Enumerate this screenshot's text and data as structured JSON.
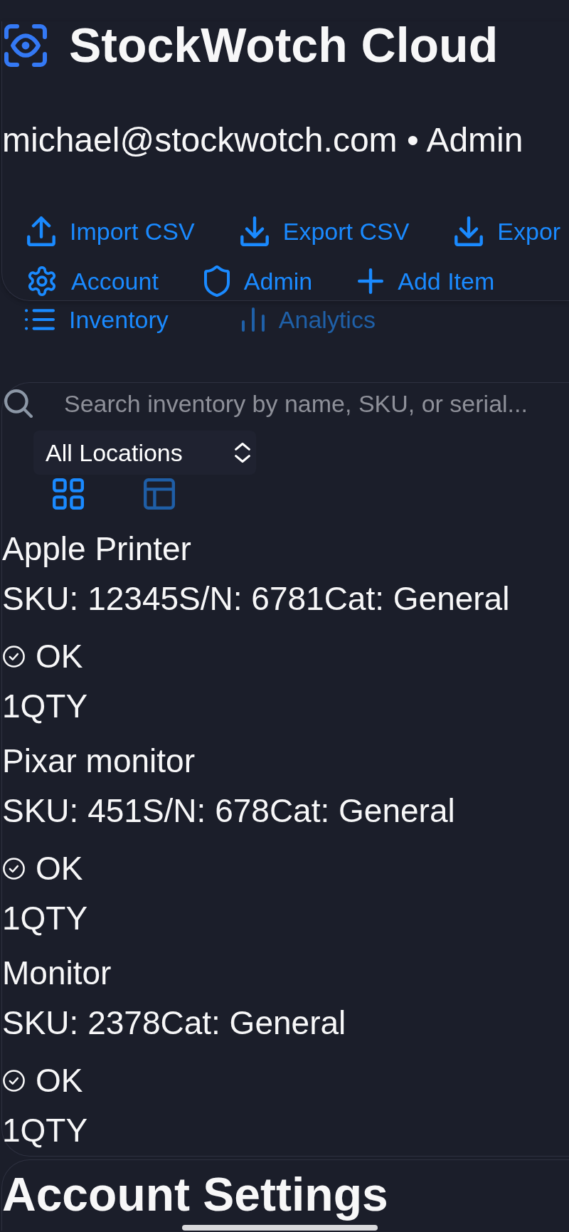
{
  "header": {
    "title": "StockWotch Cloud",
    "user_line": "michael@stockwotch.com • Admin"
  },
  "toolbar": {
    "rows": [
      {
        "buttons": [
          {
            "kind": "import",
            "label": "Import CSV"
          },
          {
            "kind": "export",
            "label": "Export CSV"
          },
          {
            "kind": "export",
            "label": "Expor"
          }
        ]
      },
      {
        "buttons": [
          {
            "kind": "settings",
            "label": "Account"
          },
          {
            "kind": "admin",
            "label": "Admin"
          },
          {
            "kind": "add",
            "label": "Add Item"
          }
        ]
      }
    ]
  },
  "tabs": [
    {
      "kind": "list",
      "label": "Inventory",
      "selected": true
    },
    {
      "kind": "chart",
      "label": "Analytics",
      "selected": false
    }
  ],
  "search": {
    "placeholder": "Search inventory by name, SKU, or serial..."
  },
  "location_filter": {
    "value": "All Locations"
  },
  "view_modes": [
    {
      "kind": "grid",
      "selected": true
    },
    {
      "kind": "table",
      "selected": false
    }
  ],
  "items": [
    {
      "name": "Apple Printer",
      "details": "SKU: 12345S/N: 6781Cat: General",
      "status": "OK",
      "quantity": "1QTY"
    },
    {
      "name": "Pixar monitor",
      "details": "SKU: 451S/N: 678Cat: General",
      "status": "OK",
      "quantity": "1QTY"
    },
    {
      "name": "Monitor",
      "details": "SKU: 2378Cat: General",
      "status": "OK",
      "quantity": "1QTY"
    }
  ],
  "account_settings": {
    "title": "Account Settings"
  }
}
